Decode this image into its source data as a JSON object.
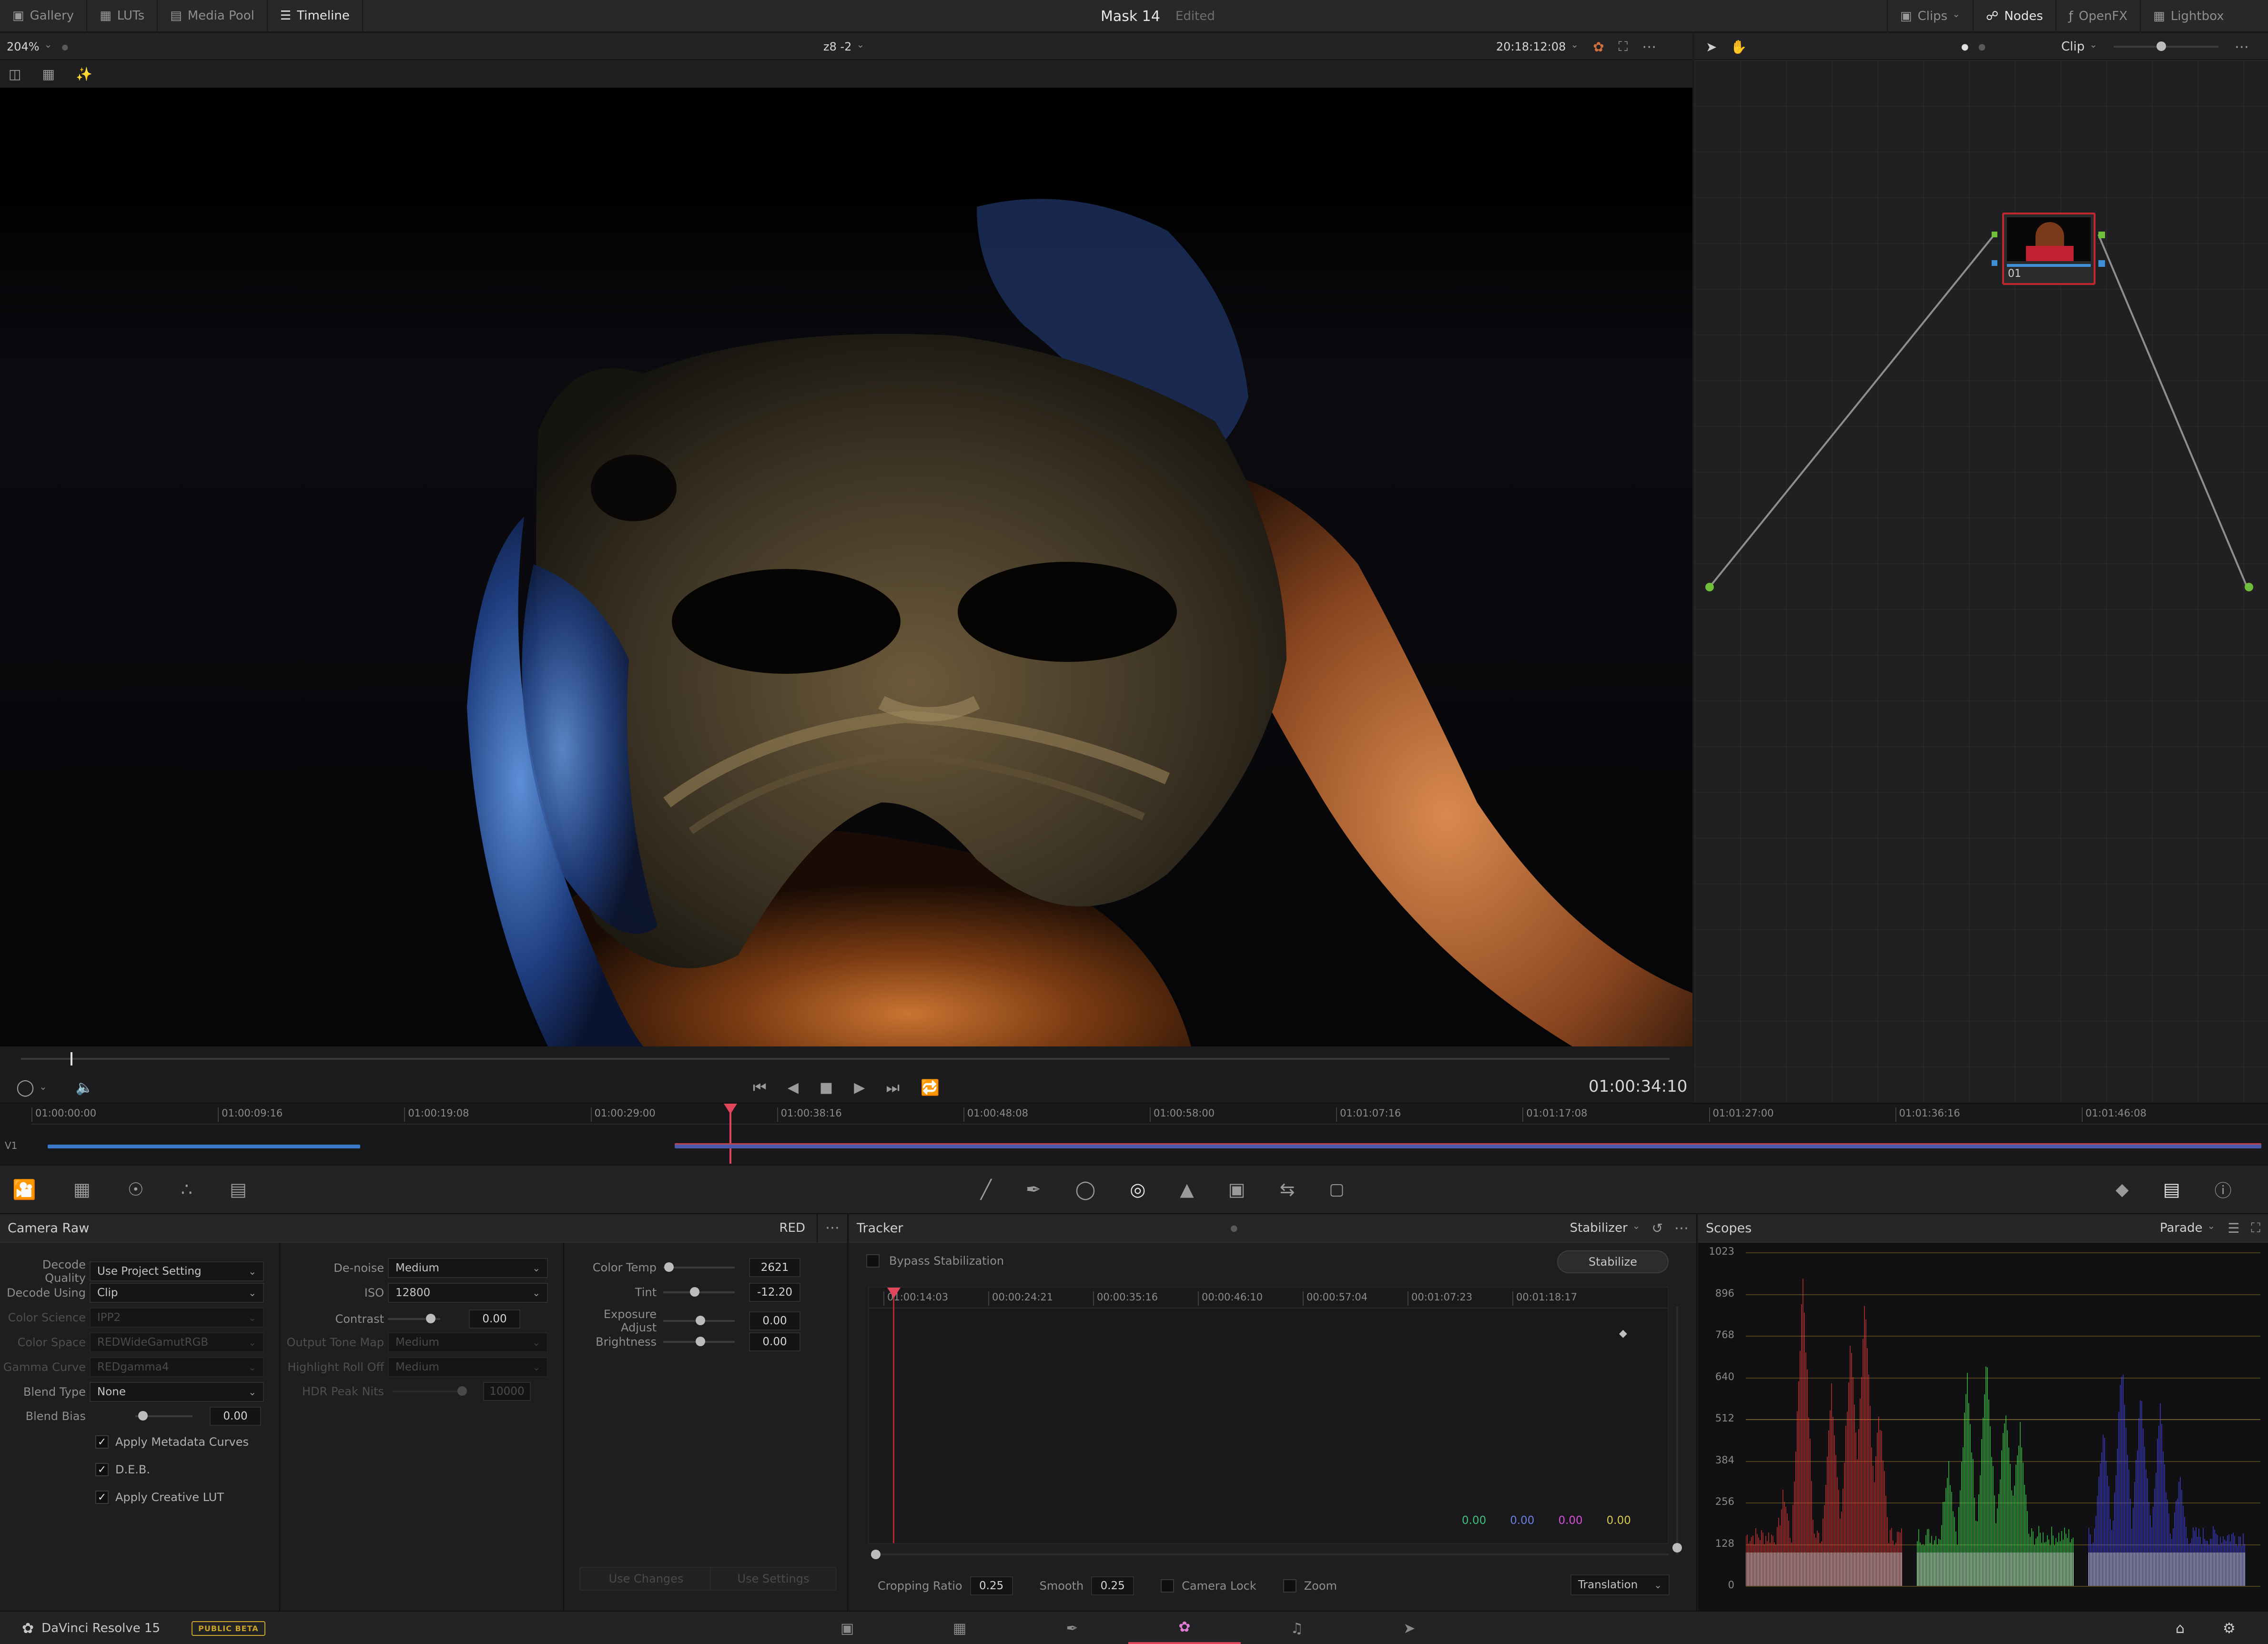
{
  "topbar": {
    "gallery": "Gallery",
    "luts": "LUTs",
    "media_pool": "Media Pool",
    "timeline": "Timeline",
    "title": "Mask 14",
    "edited": "Edited",
    "clips": "Clips",
    "nodes": "Nodes",
    "openfx": "OpenFX",
    "lightbox": "Lightbox"
  },
  "viewer": {
    "zoom": "204%",
    "clip_name": "z8 -2",
    "timecode_top": "20:18:12:08",
    "timecode_main": "01:00:34:10",
    "scrub_position": 0.03
  },
  "nodes": {
    "mode": "Clip",
    "node_label": "01"
  },
  "mini_timeline": {
    "track": "V1",
    "ticks": [
      "01:00:00:00",
      "01:00:09:16",
      "01:00:19:08",
      "01:00:29:00",
      "01:00:38:16",
      "01:00:48:08",
      "01:00:58:00",
      "01:01:07:16",
      "01:01:17:08",
      "01:01:27:00",
      "01:01:36:16",
      "01:01:46:08"
    ],
    "playhead": 0.312
  },
  "camera_raw": {
    "title": "Camera Raw",
    "format": "RED",
    "decode_quality_label": "Decode Quality",
    "decode_quality": "Use Project Setting",
    "decode_using_label": "Decode Using",
    "decode_using": "Clip",
    "color_science_label": "Color Science",
    "color_science": "IPP2",
    "color_space_label": "Color Space",
    "color_space": "REDWideGamutRGB",
    "gamma_curve_label": "Gamma Curve",
    "gamma_curve": "REDgamma4",
    "blend_type_label": "Blend Type",
    "blend_type": "None",
    "blend_bias_label": "Blend Bias",
    "blend_bias": "0.00",
    "apply_metadata_curves": "Apply Metadata Curves",
    "deb": "D.E.B.",
    "apply_creative_lut": "Apply Creative LUT",
    "denoise_label": "De-noise",
    "denoise": "Medium",
    "iso_label": "ISO",
    "iso": "12800",
    "contrast_label": "Contrast",
    "contrast": "0.00",
    "output_tone_map_label": "Output Tone Map",
    "output_tone_map": "Medium",
    "highlight_roll_off_label": "Highlight Roll Off",
    "highlight_roll_off": "Medium",
    "hdr_peak_nits_label": "HDR Peak Nits",
    "hdr_peak_nits": "10000",
    "color_temp_label": "Color Temp",
    "color_temp": "2621",
    "tint_label": "Tint",
    "tint": "-12.20",
    "exposure_adjust_label": "Exposure Adjust",
    "exposure_adjust": "0.00",
    "brightness_label": "Brightness",
    "brightness": "0.00",
    "use_changes": "Use Changes",
    "use_settings": "Use Settings"
  },
  "tracker": {
    "title": "Tracker",
    "mode": "Stabilizer",
    "bypass": "Bypass Stabilization",
    "stabilize": "Stabilize",
    "ticks": [
      "01:00:14:03",
      "00:00:24:21",
      "00:00:35:16",
      "00:00:46:10",
      "00:00:57:04",
      "00:01:07:23",
      "00:01:18:17"
    ],
    "values": [
      "0.00",
      "0.00",
      "0.00",
      "0.00"
    ],
    "value_colors": [
      "#3fbf7f",
      "#6a7fe0",
      "#d64fd6",
      "#d6c84f"
    ],
    "cropping_ratio_label": "Cropping Ratio",
    "cropping_ratio": "0.25",
    "smooth_label": "Smooth",
    "smooth": "0.25",
    "camera_lock": "Camera Lock",
    "zoom": "Zoom",
    "translation": "Translation"
  },
  "scopes": {
    "title": "Scopes",
    "mode": "Parade",
    "levels": [
      "1023",
      "896",
      "768",
      "640",
      "512",
      "384",
      "256",
      "128",
      "0"
    ]
  },
  "statusbar": {
    "app": "DaVinci Resolve 15",
    "badge": "PUBLIC BETA"
  },
  "colors": {
    "accent": "#e0465a",
    "node_border": "#c0262e",
    "scope_red": "#ff3b3b",
    "scope_green": "#3bff4e",
    "scope_blue": "#4a4aff"
  }
}
